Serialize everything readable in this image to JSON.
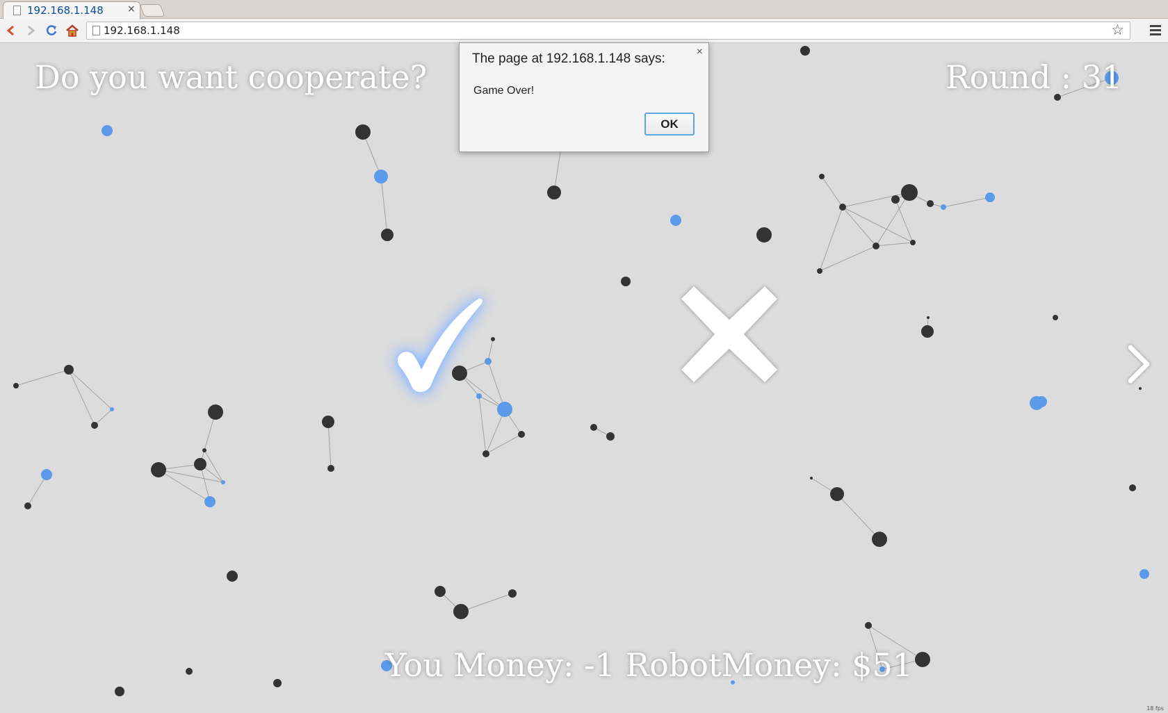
{
  "browser": {
    "tab_title": "192.168.1.148",
    "tab_close": "×",
    "url": "192.168.1.148"
  },
  "game": {
    "question": "Do you want cooperate?",
    "round_text": "Round : 31",
    "money_text": "You Money: -1 RobotMoney: $51",
    "fps": "18 fps",
    "colors": {
      "background": "#dcdcdc",
      "node_dark": "#333333",
      "node_blue": "#5b9ae8",
      "text": "#ffffff"
    }
  },
  "alert": {
    "title": "The page at 192.168.1.148 says:",
    "close": "×",
    "message": "Game Over!",
    "ok_label": "OK"
  },
  "icons": {
    "yes": "checkmark-icon",
    "no": "cross-icon",
    "next": "chevron-right-icon"
  }
}
